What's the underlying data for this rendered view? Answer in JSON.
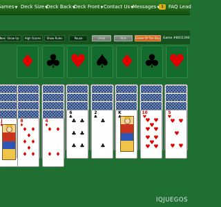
{
  "nav": {
    "items": [
      {
        "id": "games",
        "label": "Games",
        "caret": true
      },
      {
        "id": "deck-size",
        "label": "Deck Size",
        "caret": true
      },
      {
        "id": "deck-back",
        "label": "Deck Back",
        "caret": true
      },
      {
        "id": "deck-front",
        "label": "Deck Front",
        "caret": true
      },
      {
        "id": "contact-us",
        "label": "Contact Us",
        "caret": true
      },
      {
        "id": "messages",
        "label": "Messages",
        "caret": true
      }
    ],
    "badge": "1",
    "faq": "FAQ",
    "leaders": "Lead"
  },
  "toolbar": {
    "buttons": [
      {
        "id": "new-deal",
        "label": "New Deal"
      },
      {
        "id": "show-up",
        "label": "Show Up"
      },
      {
        "id": "high-scores",
        "label": "High Scores"
      },
      {
        "id": "show-rules",
        "label": "Show Rules"
      },
      {
        "id": "pause",
        "label": "Pause"
      },
      {
        "id": "undo",
        "label": "Undo"
      },
      {
        "id": "hint",
        "label": "Hint"
      },
      {
        "id": "game-of-the-day",
        "label": "Game Of The Day"
      }
    ],
    "game_label": "Game #8051390"
  },
  "foundations": [
    {
      "suit": "diamond",
      "symbol": "♦",
      "color": "#e10000"
    },
    {
      "suit": "club",
      "symbol": "♣",
      "color": "#000000"
    },
    {
      "suit": "heart",
      "symbol": "♥",
      "color": "#e10000"
    },
    {
      "suit": "spade",
      "symbol": "♠",
      "color": "#000000"
    },
    {
      "suit": "diamond",
      "symbol": "♦",
      "color": "#e10000"
    },
    {
      "suit": "club",
      "symbol": "♣",
      "color": "#000000"
    },
    {
      "suit": "heart",
      "symbol": "♥",
      "color": "#e10000"
    }
  ],
  "tableau": [
    {
      "face_down": 4,
      "top": {
        "rank": "J",
        "suit": "♦",
        "color": "red",
        "face": true
      }
    },
    {
      "face_down": 4,
      "top": {
        "rank": "8",
        "suit": "♦",
        "color": "red"
      }
    },
    {
      "face_down": 4,
      "top": {
        "rank": "4",
        "suit": "♦",
        "color": "red"
      }
    },
    {
      "face_down": 3,
      "top": {
        "rank": "6",
        "suit": "♣",
        "color": "black"
      }
    },
    {
      "face_down": 3,
      "top": {
        "rank": "2",
        "suit": "♣",
        "color": "black"
      }
    },
    {
      "face_down": 3,
      "top": {
        "rank": "K",
        "suit": "♣",
        "color": "black",
        "face": true
      }
    },
    {
      "face_down": 3,
      "top": {
        "rank": "10",
        "suit": "♥",
        "color": "red"
      }
    },
    {
      "face_down": 3,
      "top": {
        "rank": "5",
        "suit": "♥",
        "color": "red"
      }
    }
  ],
  "watermark": "IQJUEGOS"
}
